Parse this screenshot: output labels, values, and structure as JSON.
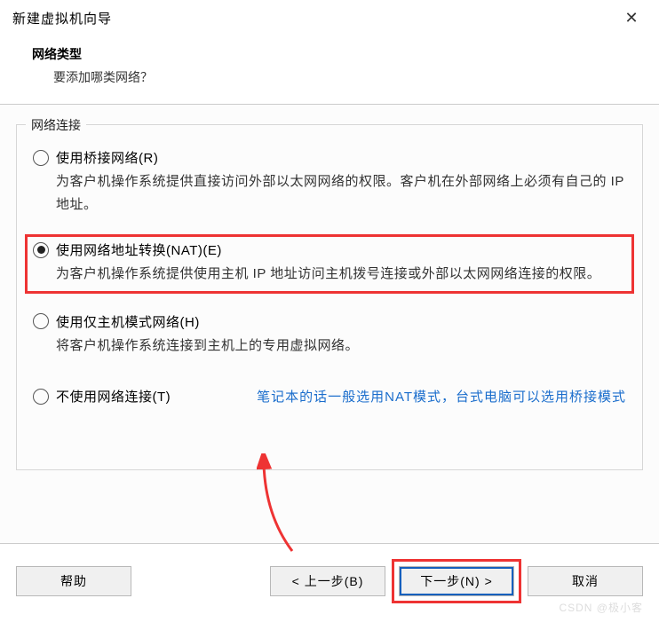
{
  "title": "新建虚拟机向导",
  "header": {
    "title": "网络类型",
    "subtitle": "要添加哪类网络？"
  },
  "fieldset_legend": "网络连接",
  "options": {
    "bridged": {
      "label": "使用桥接网络(R)",
      "desc": "为客户机操作系统提供直接访问外部以太网网络的权限。客户机在外部网络上必须有自己的 IP 地址。"
    },
    "nat": {
      "label": "使用网络地址转换(NAT)(E)",
      "desc": "为客户机操作系统提供使用主机 IP 地址访问主机拨号连接或外部以太网网络连接的权限。"
    },
    "hostonly": {
      "label": "使用仅主机模式网络(H)",
      "desc": "将客户机操作系统连接到主机上的专用虚拟网络。"
    },
    "none": {
      "label": "不使用网络连接(T)"
    }
  },
  "hint": "笔记本的话一般选用NAT模式，台式电脑可以选用桥接模式",
  "buttons": {
    "help": "帮助",
    "back": "< 上一步(B)",
    "next": "下一步(N) >",
    "cancel": "取消"
  },
  "watermark": "CSDN @极小客"
}
